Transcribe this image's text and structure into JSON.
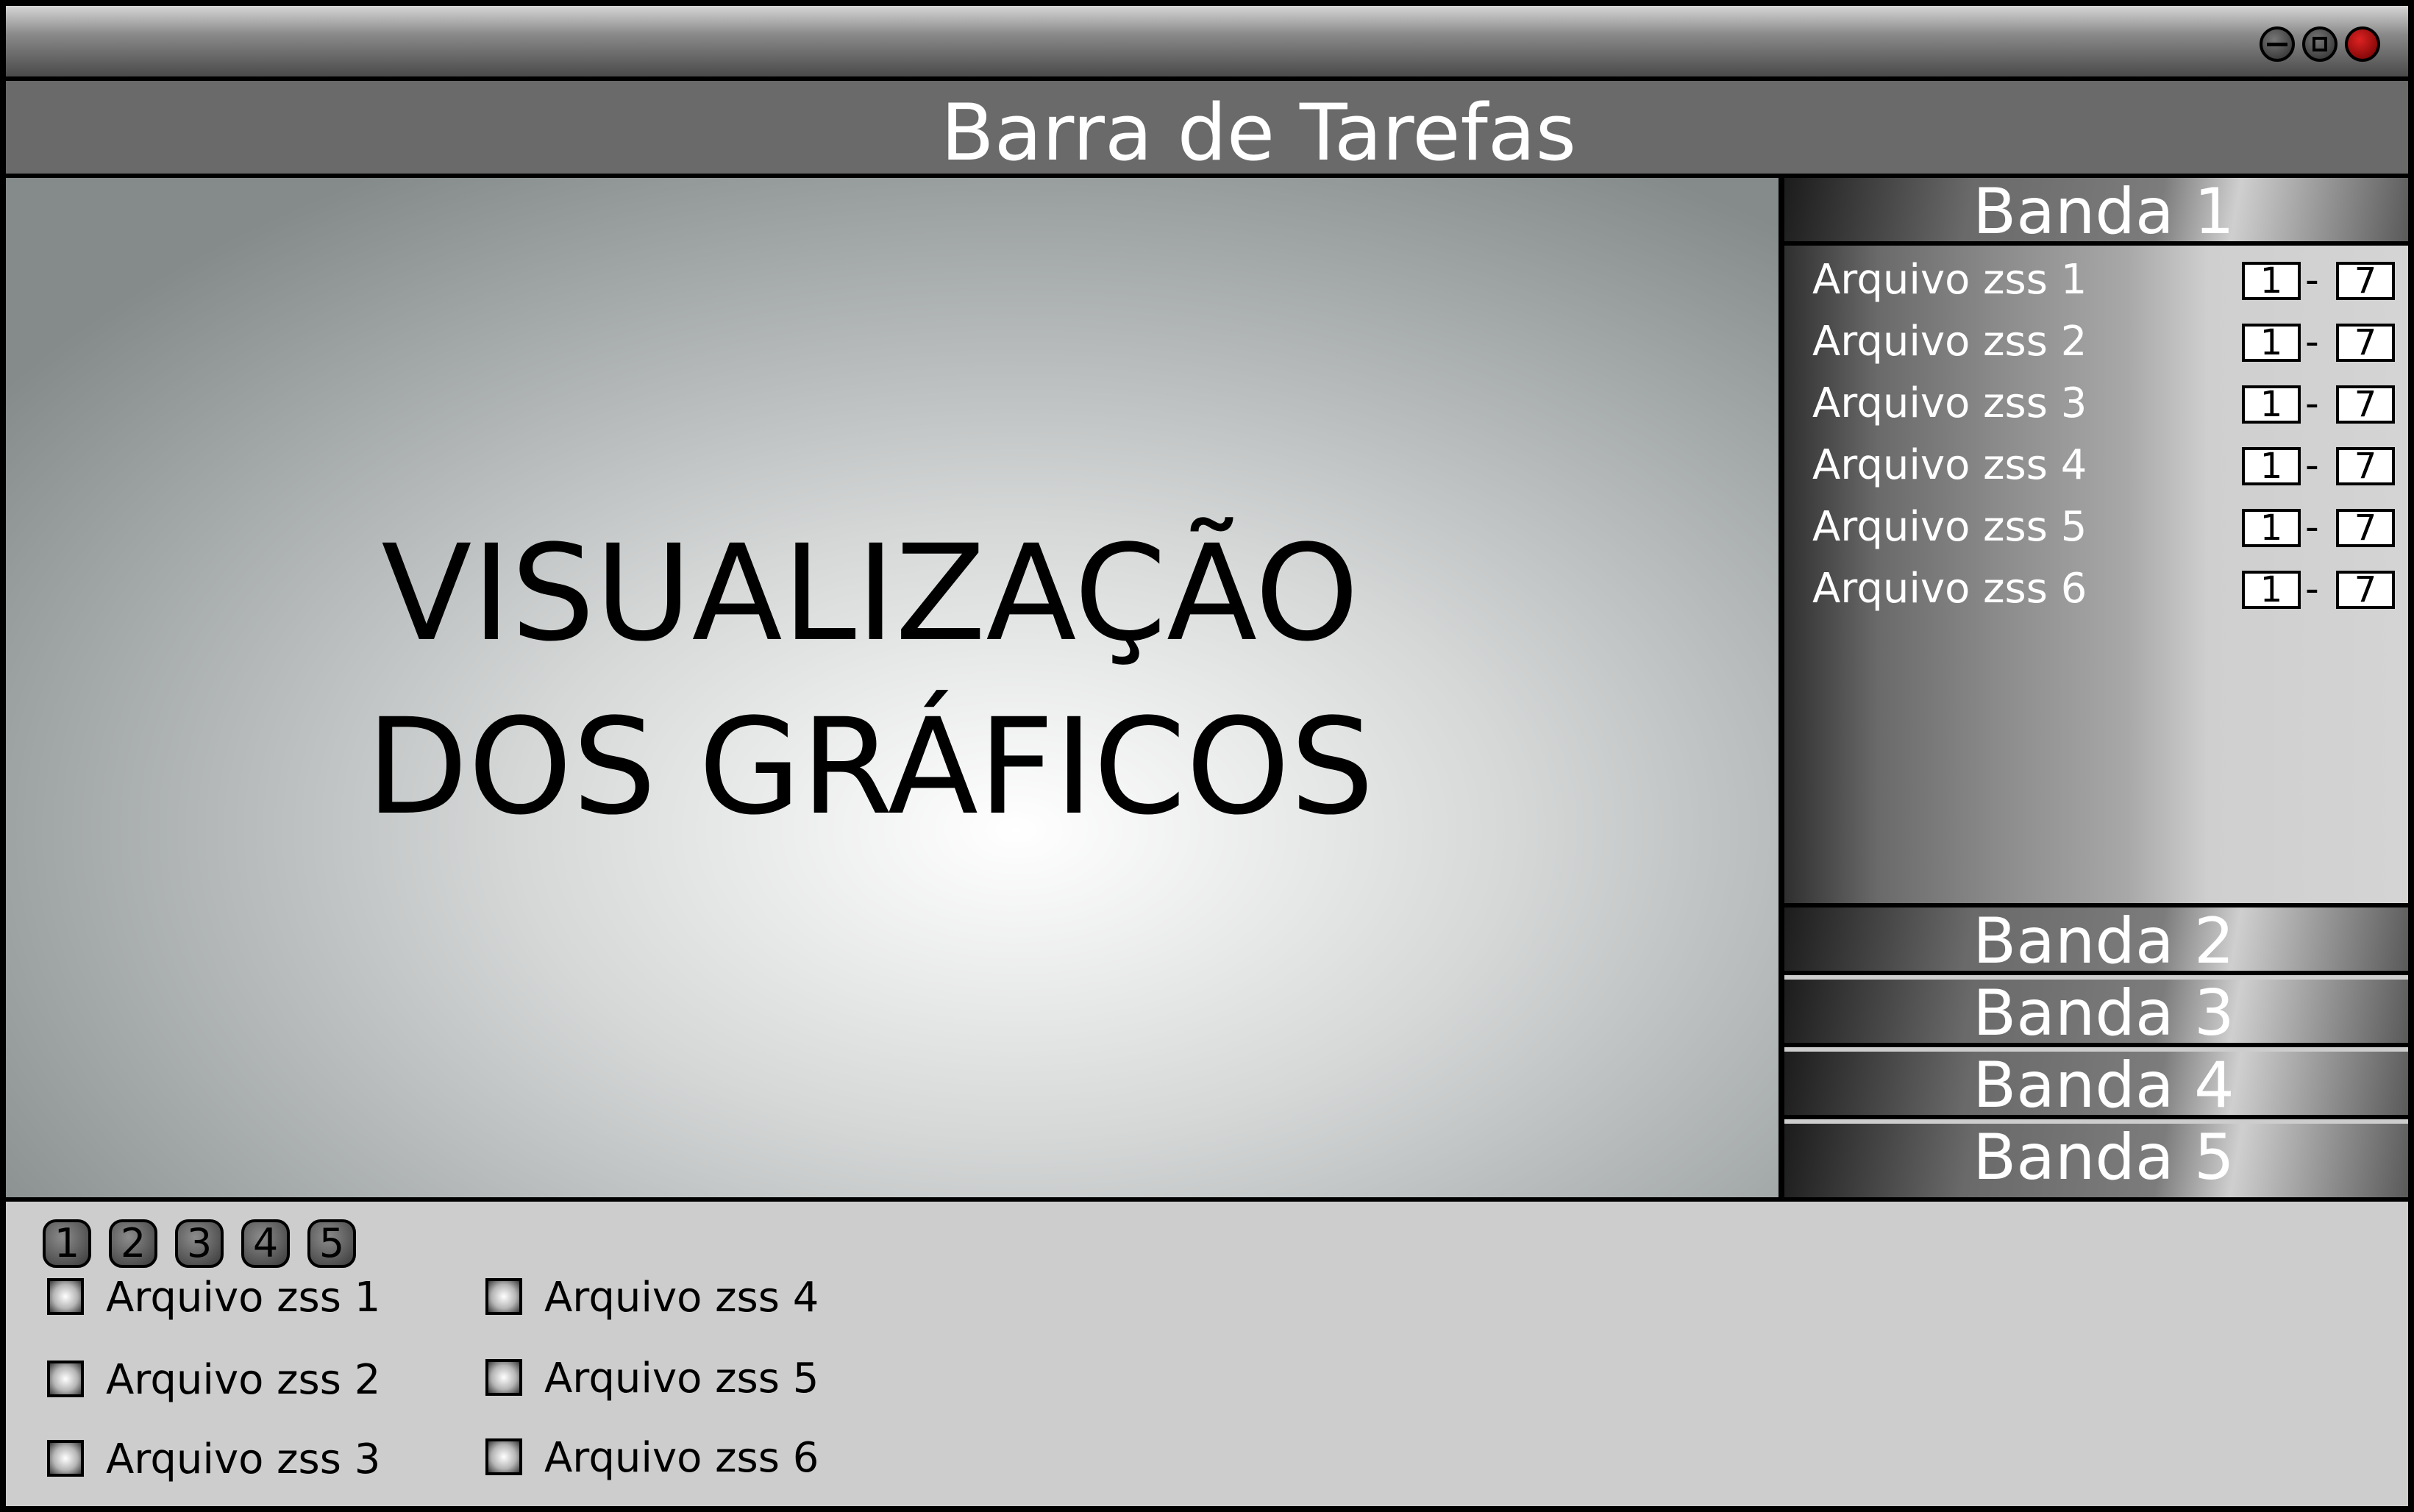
{
  "window": {
    "controls": [
      "minimize-icon",
      "maximize-icon",
      "close-icon"
    ],
    "close_color": "#c01818"
  },
  "taskbar": {
    "title": "Barra de Tarefas"
  },
  "viz": {
    "line1": "VISUALIZAÇÃO",
    "line2": "DOS GRÁFICOS"
  },
  "bands": [
    {
      "label": "Banda 1",
      "expanded": true,
      "files": [
        {
          "label": "Arquivo zss 1",
          "from": "1",
          "sep": "-",
          "to": "7"
        },
        {
          "label": "Arquivo zss 2",
          "from": "1",
          "sep": "-",
          "to": "7"
        },
        {
          "label": "Arquivo zss 3",
          "from": "1",
          "sep": "-",
          "to": "7"
        },
        {
          "label": "Arquivo zss 4",
          "from": "1",
          "sep": "-",
          "to": "7"
        },
        {
          "label": "Arquivo zss 5",
          "from": "1",
          "sep": "-",
          "to": "7"
        },
        {
          "label": "Arquivo zss 6",
          "from": "1",
          "sep": "-",
          "to": "7"
        }
      ]
    },
    {
      "label": "Banda 2",
      "expanded": false
    },
    {
      "label": "Banda 3",
      "expanded": false
    },
    {
      "label": "Banda 4",
      "expanded": false
    },
    {
      "label": "Banda 5",
      "expanded": false
    }
  ],
  "bottom": {
    "pages": [
      "1",
      "2",
      "3",
      "4",
      "5"
    ],
    "files": [
      "Arquivo zss 1",
      "Arquivo zss 2",
      "Arquivo zss 3",
      "Arquivo zss 4",
      "Arquivo zss 5",
      "Arquivo zss 6"
    ]
  }
}
